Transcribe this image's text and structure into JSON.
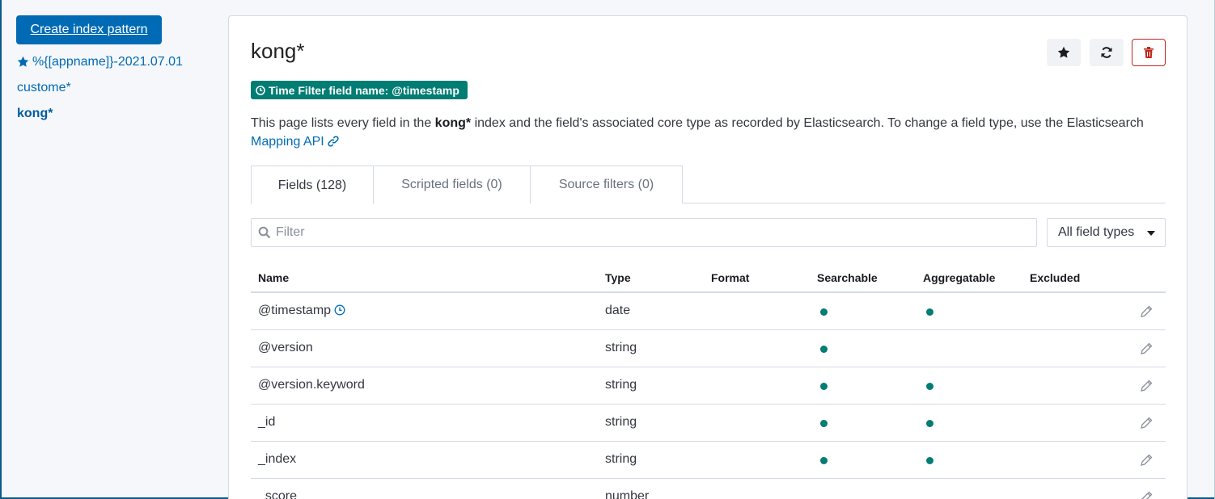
{
  "sidebar": {
    "create_button": "Create index pattern",
    "items": [
      {
        "label": "%{[appname]}-2021.07.01",
        "starred": true,
        "active": false
      },
      {
        "label": "custome*",
        "starred": false,
        "active": false
      },
      {
        "label": "kong*",
        "starred": false,
        "active": true
      }
    ]
  },
  "header": {
    "title": "kong*",
    "time_filter": "Time Filter field name: @timestamp",
    "actions": [
      "star-icon",
      "refresh-icon",
      "trash-icon"
    ]
  },
  "description": {
    "before": "This page lists every field in the ",
    "pattern": "kong*",
    "after": " index and the field's associated core type as recorded by Elasticsearch. To change a field type, use the Elasticsearch",
    "link": "Mapping API"
  },
  "tabs": [
    {
      "label": "Fields (128)",
      "active": true
    },
    {
      "label": "Scripted fields (0)",
      "active": false
    },
    {
      "label": "Source filters (0)",
      "active": false
    }
  ],
  "filter": {
    "placeholder": "Filter",
    "value": ""
  },
  "type_select": {
    "selected": "All field types"
  },
  "table": {
    "headers": [
      "Name",
      "Type",
      "Format",
      "Searchable",
      "Aggregatable",
      "Excluded"
    ],
    "rows": [
      {
        "name": "@timestamp",
        "type": "date",
        "format": "",
        "searchable": true,
        "aggregatable": true,
        "excluded": false,
        "time_field": true
      },
      {
        "name": "@version",
        "type": "string",
        "format": "",
        "searchable": true,
        "aggregatable": false,
        "excluded": false
      },
      {
        "name": "@version.keyword",
        "type": "string",
        "format": "",
        "searchable": true,
        "aggregatable": true,
        "excluded": false
      },
      {
        "name": "_id",
        "type": "string",
        "format": "",
        "searchable": true,
        "aggregatable": true,
        "excluded": false
      },
      {
        "name": "_index",
        "type": "string",
        "format": "",
        "searchable": true,
        "aggregatable": true,
        "excluded": false
      },
      {
        "name": "_score",
        "type": "number",
        "format": "",
        "searchable": false,
        "aggregatable": false,
        "excluded": false
      }
    ]
  },
  "colors": {
    "accent": "#006bb4",
    "success": "#017d73",
    "danger": "#bd271e",
    "border": "#d3dae6"
  }
}
